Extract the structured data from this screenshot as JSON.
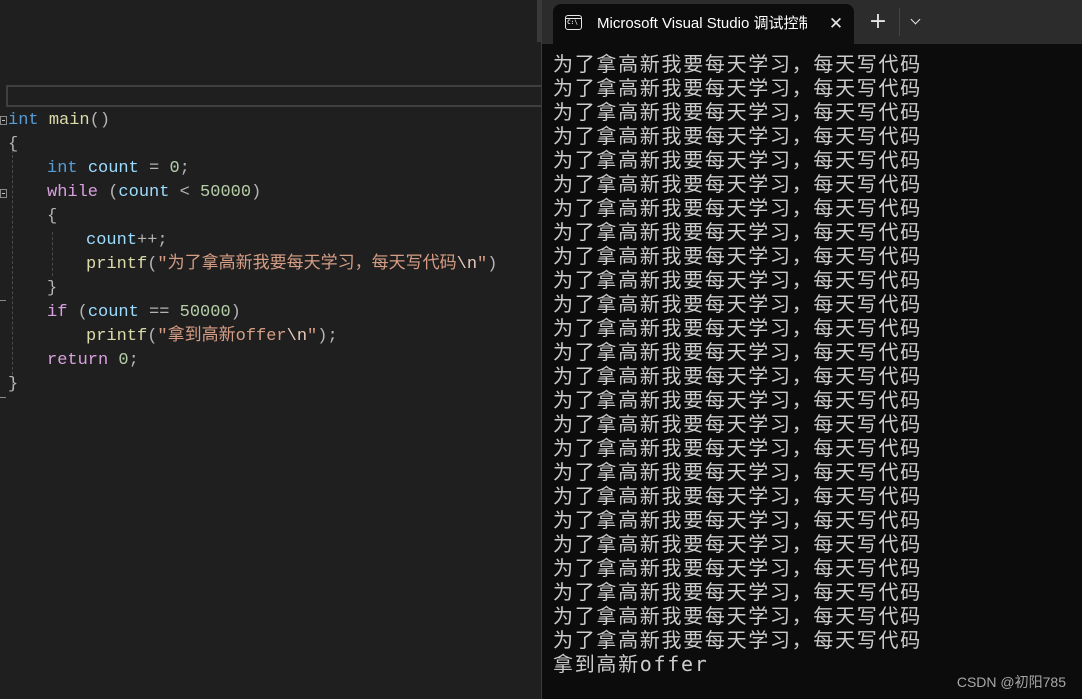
{
  "editor": {
    "code_lines": [
      {
        "tokens": [
          {
            "c": "kw",
            "t": "int"
          },
          {
            "c": "",
            "t": " "
          },
          {
            "c": "fn",
            "t": "main"
          },
          {
            "c": "punc",
            "t": "()"
          }
        ]
      },
      {
        "tokens": [
          {
            "c": "punc",
            "t": "{"
          }
        ]
      },
      {
        "tokens": [
          {
            "c": "kw",
            "t": "int"
          },
          {
            "c": "",
            "t": " "
          },
          {
            "c": "var",
            "t": "count"
          },
          {
            "c": "punc",
            "t": " = "
          },
          {
            "c": "num",
            "t": "0"
          },
          {
            "c": "punc",
            "t": ";"
          }
        ]
      },
      {
        "tokens": [
          {
            "c": "kw2",
            "t": "while"
          },
          {
            "c": "punc",
            "t": " ("
          },
          {
            "c": "var",
            "t": "count"
          },
          {
            "c": "punc",
            "t": " < "
          },
          {
            "c": "num",
            "t": "50000"
          },
          {
            "c": "punc",
            "t": ")"
          }
        ]
      },
      {
        "tokens": [
          {
            "c": "punc",
            "t": "{"
          }
        ]
      },
      {
        "tokens": [
          {
            "c": "var",
            "t": "count"
          },
          {
            "c": "punc",
            "t": "++;"
          }
        ]
      },
      {
        "tokens": [
          {
            "c": "fn",
            "t": "printf"
          },
          {
            "c": "punc",
            "t": "("
          },
          {
            "c": "str",
            "t": "\"为了拿高新我要每天学习，每天写代码"
          },
          {
            "c": "esc",
            "t": "\\n"
          },
          {
            "c": "str",
            "t": "\""
          },
          {
            "c": "punc",
            "t": ")"
          }
        ]
      },
      {
        "tokens": [
          {
            "c": "punc",
            "t": "}"
          }
        ]
      },
      {
        "tokens": [
          {
            "c": "kw2",
            "t": "if"
          },
          {
            "c": "punc",
            "t": " ("
          },
          {
            "c": "var",
            "t": "count"
          },
          {
            "c": "punc",
            "t": " == "
          },
          {
            "c": "num",
            "t": "50000"
          },
          {
            "c": "punc",
            "t": ")"
          }
        ]
      },
      {
        "tokens": [
          {
            "c": "fn",
            "t": "printf"
          },
          {
            "c": "punc",
            "t": "("
          },
          {
            "c": "str",
            "t": "\"拿到高新offer"
          },
          {
            "c": "esc",
            "t": "\\n"
          },
          {
            "c": "str",
            "t": "\""
          },
          {
            "c": "punc",
            "t": ");"
          }
        ]
      },
      {
        "tokens": [
          {
            "c": "kw2",
            "t": "return"
          },
          {
            "c": "",
            "t": " "
          },
          {
            "c": "num",
            "t": "0"
          },
          {
            "c": "punc",
            "t": ";"
          }
        ]
      },
      {
        "tokens": [
          {
            "c": "punc",
            "t": "}"
          }
        ]
      }
    ]
  },
  "terminal": {
    "tab_title": "Microsoft Visual Studio 调试控制台",
    "tab_icon": "console-icon",
    "tab_icon_text": "C:\\",
    "close_glyph": "✕",
    "new_tab_glyph": "+",
    "repeated_line": "为了拿高新我要每天学习，每天写代码",
    "repeated_count": 25,
    "final_line": "拿到高新offer"
  },
  "watermark": "CSDN @初阳785"
}
